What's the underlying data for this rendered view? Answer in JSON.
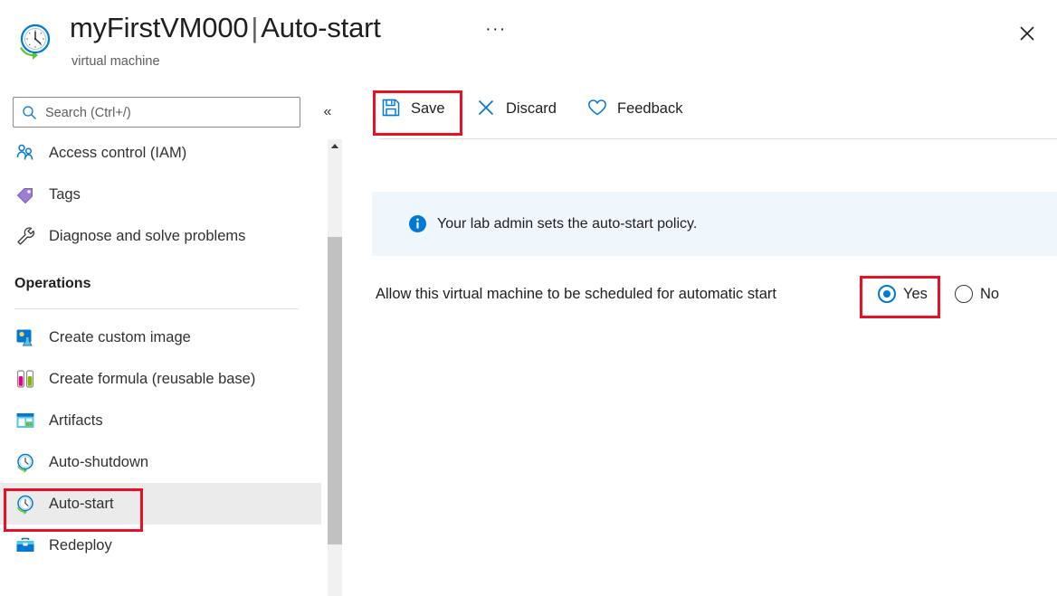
{
  "header": {
    "icon": "auto-start-clock-icon",
    "resource_name": "myFirstVM000",
    "separator": "|",
    "page_name": "Auto-start",
    "title_full": "myFirstVM000 | Auto-start",
    "subtitle": "virtual machine",
    "ellipsis": "···",
    "close_icon": "close-icon"
  },
  "sidebar": {
    "search": {
      "placeholder": "Search (Ctrl+/)",
      "value": "",
      "icon": "search-icon"
    },
    "collapse": {
      "label": "«",
      "icon": "chevron-double-left-icon"
    },
    "items": [
      {
        "label": "Access control (IAM)",
        "icon": "people-icon",
        "selected": false
      },
      {
        "label": "Tags",
        "icon": "tag-icon",
        "selected": false
      },
      {
        "label": "Diagnose and solve problems",
        "icon": "wrench-icon",
        "selected": false
      }
    ],
    "group": {
      "title": "Operations",
      "items": [
        {
          "label": "Create custom image",
          "icon": "custom-image-icon",
          "selected": false
        },
        {
          "label": "Create formula (reusable base)",
          "icon": "formula-icon",
          "selected": false
        },
        {
          "label": "Artifacts",
          "icon": "artifacts-icon",
          "selected": false
        },
        {
          "label": "Auto-shutdown",
          "icon": "clock-icon",
          "selected": false
        },
        {
          "label": "Auto-start",
          "icon": "clock-icon",
          "selected": true
        },
        {
          "label": "Redeploy",
          "icon": "toolbox-icon",
          "selected": false
        }
      ]
    },
    "scrollbar": {
      "up_arrow": "scroll-up-arrow-icon"
    }
  },
  "toolbar": {
    "save_label": "Save",
    "save_icon": "save-floppy-icon",
    "discard_label": "Discard",
    "discard_icon": "close-x-icon",
    "feedback_label": "Feedback",
    "feedback_icon": "heart-icon"
  },
  "main": {
    "info_banner": {
      "icon": "info-icon",
      "text": "Your lab admin sets the auto-start policy.",
      "background": "#eff6fc"
    },
    "setting": {
      "label": "Allow this virtual machine to be scheduled for automatic start",
      "options": [
        {
          "label": "Yes",
          "checked": true
        },
        {
          "label": "No",
          "checked": false
        }
      ]
    }
  },
  "annotations": {
    "accent_color": "#e81123",
    "boxes": [
      {
        "target": "save-button"
      },
      {
        "target": "sidebar-item-auto-start"
      },
      {
        "target": "radio-option-yes"
      }
    ]
  },
  "colors": {
    "azure_blue": "#0078d4",
    "selected_nav_bg": "#ebebeb",
    "info_bg": "#eff6fc",
    "annotation_red": "#e81123"
  }
}
